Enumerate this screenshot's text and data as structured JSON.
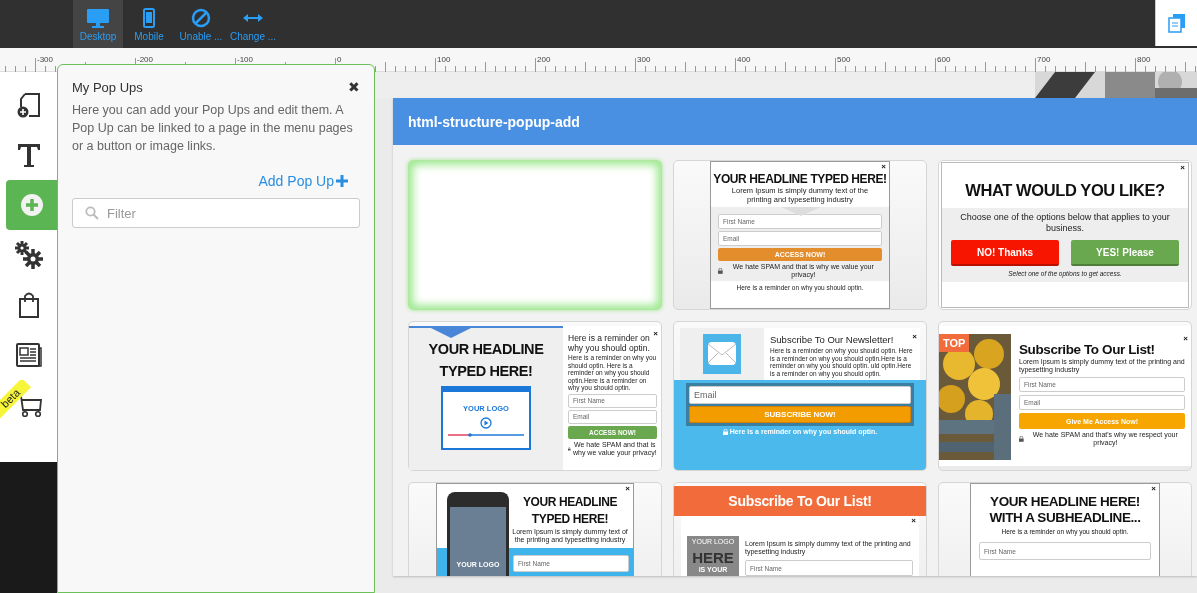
{
  "toolbar": [
    {
      "label": "Desktop",
      "kind": "desktop",
      "selected": true
    },
    {
      "label": "Mobile",
      "kind": "mobile",
      "selected": false
    },
    {
      "label": "Unable ...",
      "kind": "block",
      "selected": false
    },
    {
      "label": "Change ...",
      "kind": "resize",
      "selected": false
    }
  ],
  "ruler": [
    "-300",
    "-200",
    "-100",
    "0",
    "100",
    "200",
    "300",
    "400",
    "500",
    "600",
    "700",
    "800"
  ],
  "sidebar": [
    {
      "kind": "page",
      "selected": false
    },
    {
      "kind": "text",
      "selected": false
    },
    {
      "kind": "add",
      "selected": true
    },
    {
      "kind": "settings",
      "selected": false
    },
    {
      "kind": "bag",
      "selected": false
    },
    {
      "kind": "news",
      "selected": false
    },
    {
      "kind": "cart",
      "selected": false,
      "badge": "beta"
    }
  ],
  "panel": {
    "title": "My Pop Ups",
    "close": "✖",
    "description": "Here you can add your Pop Ups and edit them. A Pop Up can be linked to a page in the menu pages or a button or image links.",
    "add_link": "Add Pop Up",
    "filter": {
      "placeholder": "Filter"
    }
  },
  "dialog": {
    "title": "html-structure-popup-add",
    "templates": [
      {
        "kind": "blank",
        "selected": true
      },
      {
        "kind": "headline-form",
        "selected": false,
        "close": "×",
        "headline": "YOUR HEADLINE TYPED HERE!",
        "body": "Lorem Ipsum is simply dummy text of the printing and typesetting industry",
        "fields": [
          "First Name",
          "Email"
        ],
        "button": "ACCESS NOW!",
        "note": "We hate SPAM and that is why we value your privacy!",
        "footer": "Here is a reminder on why you should optin."
      },
      {
        "kind": "choice",
        "selected": false,
        "close": "×",
        "headline": "WHAT WOULD YOU LIKE?",
        "body": "Choose one of the options below that applies to your business.",
        "buttons": [
          "NO! Thanks",
          "YES! Please"
        ],
        "note": "Select one of the options to get access."
      },
      {
        "kind": "video",
        "selected": false,
        "close": "×",
        "headline": "YOUR HEADLINE TYPED HERE!",
        "logo": "YOUR LOGO",
        "heading": "Here is a reminder on why you should optin.",
        "body": "Here is a reminder on why you should optin. Here is a reminder on why you should optin.Here is a reminder on why you should optin.",
        "fields": [
          "First Name",
          "Email"
        ],
        "button": "ACCESS NOW!",
        "note": "We hate SPAM and that is why we value your privacy!"
      },
      {
        "kind": "newsletter",
        "selected": false,
        "close": "×",
        "heading": "Subscribe To Our Newsletter!",
        "body": "Here is a reminder on why you should optin. Here is a reminder on why you should optin.Here is a reminder on why you should optin. uld optin.Here is a reminder on why you should optin.",
        "fields": [
          "Email"
        ],
        "button": "SUBSCRIBE NOW!",
        "note": "Here is a reminder on why you should optin."
      },
      {
        "selected": false,
        "close": "×",
        "ribbon": "TOP",
        "headline": "Subscribe To Our List!",
        "body": "Lorem Ipsum is simply dummy text of the printing and typesetting industry",
        "fields": [
          "First Name",
          "Email"
        ],
        "button": "Give Me Access Now!",
        "note": "We hate SPAM and that's why we respect your privacy!"
      },
      {
        "kind": "phone",
        "selected": false,
        "close": "×",
        "headline": "YOUR HEADLINE TYPED HERE!",
        "logo": "YOUR LOGO",
        "body": "Lorem Ipsum is simply dummy text of the printing and typesetting industry",
        "fields": [
          "First Name"
        ]
      },
      {
        "kind": "banner",
        "selected": false,
        "close": "×",
        "banner": "Subscribe To Our List!",
        "logo": "YOUR LOGO",
        "image_text": [
          "HERE",
          "IS YOUR"
        ],
        "body": "Lorem Ipsum is simply dummy text of the printing and typesetting industry",
        "fields": [
          "First Name"
        ]
      },
      {
        "kind": "subheadline",
        "selected": false,
        "close": "×",
        "headline": "YOUR HEADLINE HERE! WITH A SUBHEADLINE...",
        "body": "Here is a reminder on why you should optin.",
        "fields": [
          "First Name"
        ]
      }
    ]
  }
}
